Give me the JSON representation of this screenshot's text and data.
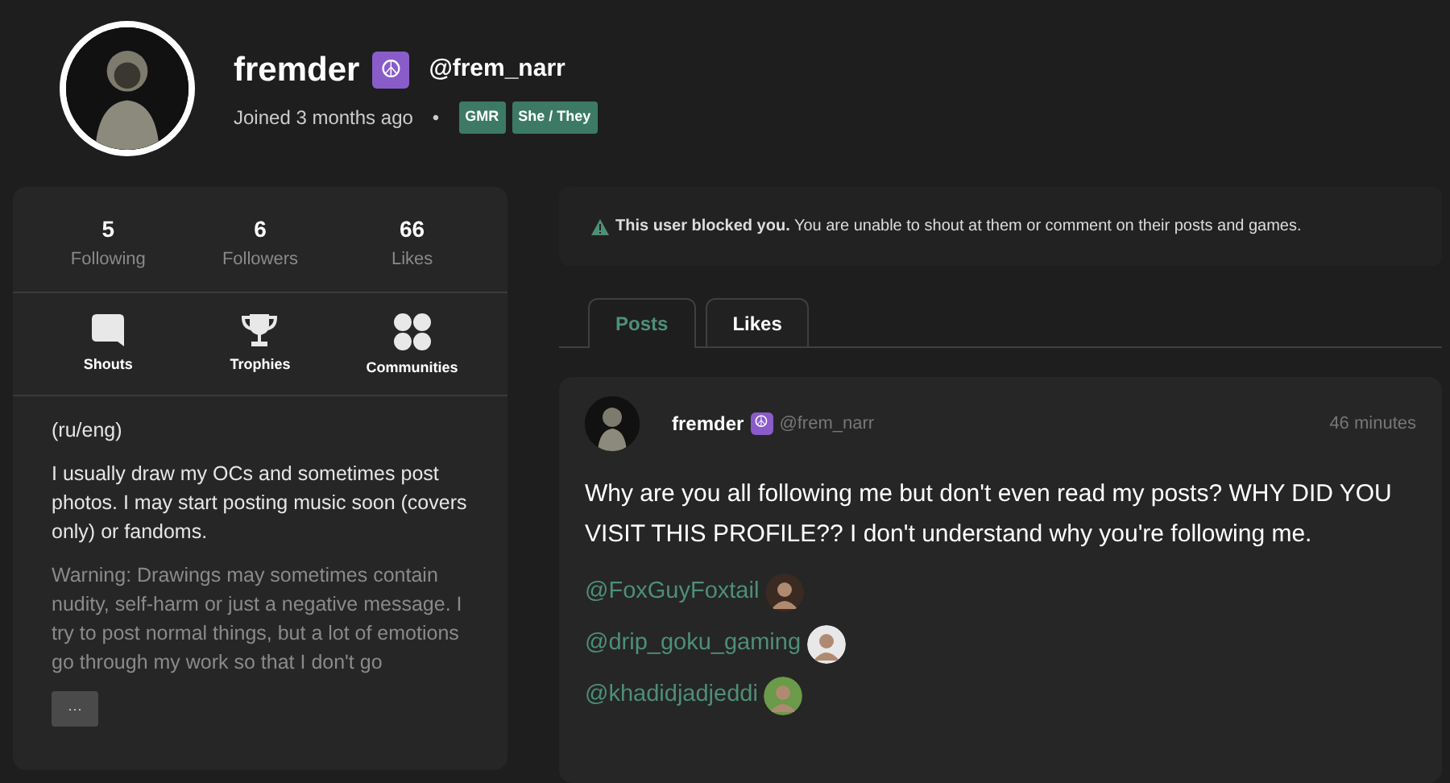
{
  "profile": {
    "display_name": "fremder",
    "name_badge": "☮",
    "handle": "@frem_narr",
    "joined": "Joined 3 months ago",
    "separator": "•",
    "tags": [
      "GMR",
      "She / They"
    ]
  },
  "stats": [
    {
      "value": "5",
      "label": "Following"
    },
    {
      "value": "6",
      "label": "Followers"
    },
    {
      "value": "66",
      "label": "Likes"
    }
  ],
  "shortcuts": [
    {
      "kind": "shouts",
      "label": "Shouts"
    },
    {
      "kind": "trophies",
      "label": "Trophies"
    },
    {
      "kind": "communities",
      "label": "Communities"
    }
  ],
  "bio": [
    {
      "text": "(ru/eng)",
      "faded": false
    },
    {
      "text": "I usually draw my OCs and sometimes post photos. I may start posting music soon (covers only) or fandoms.",
      "faded": false
    },
    {
      "text": "Warning: Drawings may sometimes contain nudity, self-harm or just a negative message. I try to post normal things, but a lot of emotions go through my work so that I don't go",
      "faded": true
    }
  ],
  "bio_more": "···",
  "alert": {
    "text": "**This user blocked you.** You are unable to shout at them or comment on their posts and games."
  },
  "tabs": [
    {
      "label": "Posts",
      "selected": true
    },
    {
      "label": "Likes",
      "selected": false
    }
  ],
  "post": {
    "author": "fremder",
    "author_badge": "☮",
    "handle": "@frem_narr",
    "time": "46 minutes",
    "body": "Why are you all following me but don't even read my posts? WHY DID YOU VISIT THIS PROFILE?? I don't understand why you're following me.",
    "mentions": [
      {
        "handle": "@FoxGuyFoxtail",
        "color": "#3a2a22"
      },
      {
        "handle": "@drip_goku_gaming",
        "color": "#e8e8e8"
      },
      {
        "handle": "@khadidjadjeddi",
        "color": "#6a9a4a"
      }
    ]
  }
}
